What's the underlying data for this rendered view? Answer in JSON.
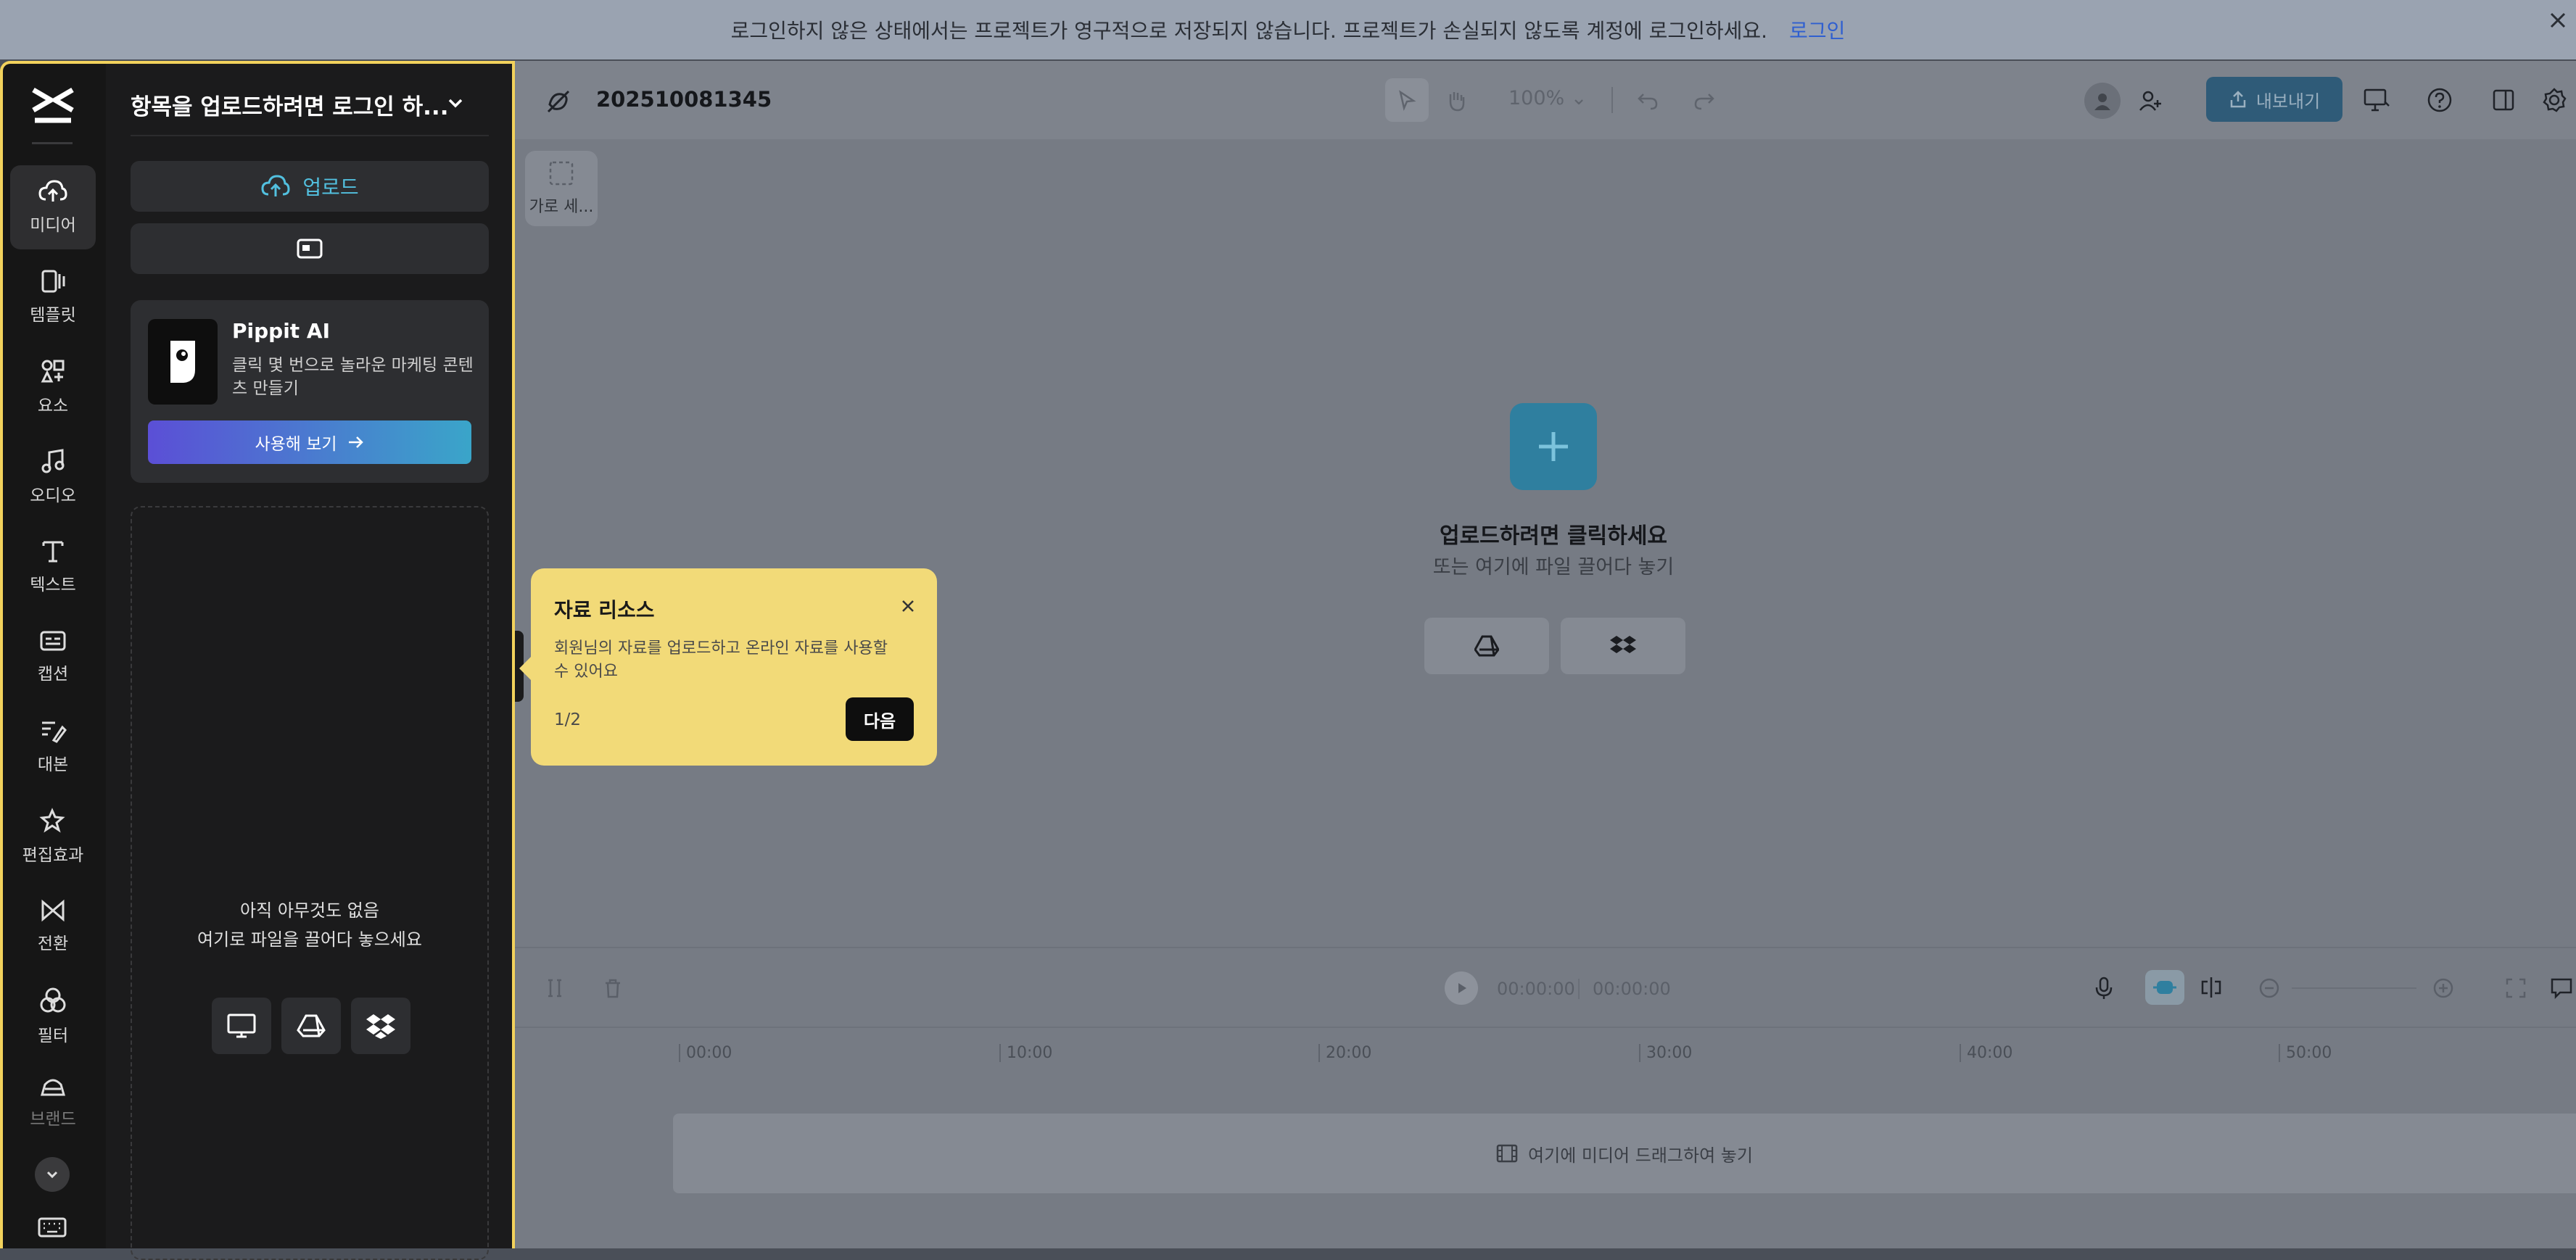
{
  "banner": {
    "message": "로그인하지 않은 상태에서는 프로젝트가 영구적으로 저장되지 않습니다. 프로젝트가 손실되지 않도록 계정에 로그인하세요.",
    "login_link": "로그인"
  },
  "rail": {
    "items": [
      {
        "label": "미디어",
        "icon": "cloud-upload-icon"
      },
      {
        "label": "템플릿",
        "icon": "template-icon"
      },
      {
        "label": "요소",
        "icon": "elements-icon"
      },
      {
        "label": "오디오",
        "icon": "music-icon"
      },
      {
        "label": "텍스트",
        "icon": "text-icon"
      },
      {
        "label": "캡션",
        "icon": "caption-icon"
      },
      {
        "label": "대본",
        "icon": "script-icon"
      },
      {
        "label": "편집효과",
        "icon": "effects-icon"
      },
      {
        "label": "전환",
        "icon": "transition-icon"
      },
      {
        "label": "필터",
        "icon": "filter-icon"
      },
      {
        "label": "브랜드",
        "icon": "brand-icon"
      }
    ]
  },
  "panel": {
    "title": "항목을 업로드하려면 로그인 하...",
    "upload_label": "업로드",
    "promo": {
      "title": "Pippit AI",
      "line1": "클릭 몇 번으로 놀라운 마케팅 콘텐",
      "line2": "츠 만들기",
      "cta": "사용해 보기"
    },
    "empty_line1": "아직 아무것도 없음",
    "empty_line2": "여기로 파일을 끌어다 놓으세요"
  },
  "editor": {
    "project_name": "202510081345",
    "zoom": "100%",
    "export_label": "내보내기",
    "ratio_label": "가로 세...",
    "upload_title": "업로드하려면 클릭하세요",
    "upload_sub": "또는 여기에 파일 끌어다 놓기",
    "time_current": "00:00:00",
    "time_total": "00:00:00",
    "ticks": [
      "00:00",
      "10:00",
      "20:00",
      "30:00",
      "40:00",
      "50:00"
    ],
    "drop_hint": "여기에 미디어 드래그하여 놓기"
  },
  "tooltip": {
    "title": "자료 리소스",
    "body_line1": "회원님의 자료를 업로드하고 온라인 자료를 사용할",
    "body_line2": "수 있어요",
    "step": "1/2",
    "next": "다음"
  },
  "colors": {
    "highlight": "#f2d25c",
    "tooltip_bg": "#f2da78",
    "cta_from": "#5b4fd6",
    "cta_to": "#3aa5c9",
    "accent": "#3ea7c9"
  }
}
